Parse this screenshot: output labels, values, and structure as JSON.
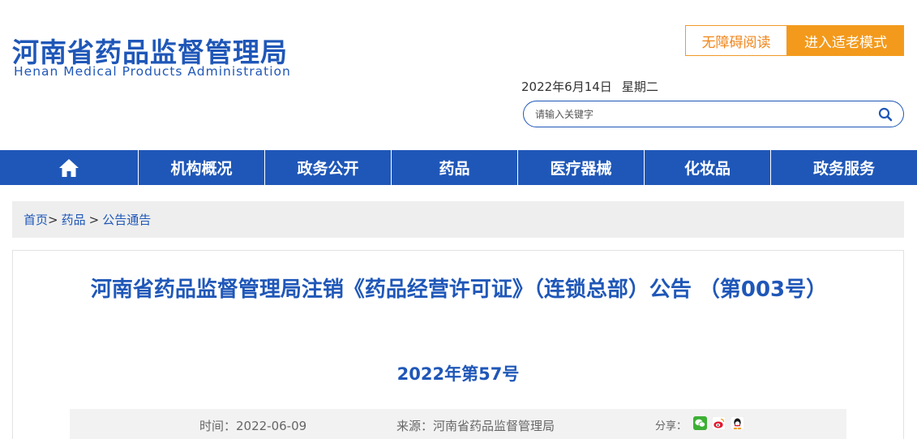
{
  "header": {
    "logo_cn": "河南省药品监督管理局",
    "logo_en": "Henan Medical Products Administration",
    "accessible_label": "无障碍阅读",
    "elder_mode_label": "进入适老模式",
    "date": "2022年6月14日",
    "weekday": "星期二",
    "search_placeholder": "请输入关键字"
  },
  "nav": {
    "items": [
      "机构概况",
      "政务公开",
      "药品",
      "医疗器械",
      "化妆品",
      "政务服务"
    ]
  },
  "breadcrumb": {
    "home": "首页",
    "level1": "药品",
    "level2": "公告通告",
    "sep1": ">",
    "sep2": ">"
  },
  "article": {
    "title": "河南省药品监督管理局注销《药品经营许可证》（连锁总部）公告 （第003号）",
    "number": "2022年第57号",
    "time": "时间：2022-06-09",
    "source": "来源：河南省药品监督管理局",
    "share_label": "分享："
  },
  "colors": {
    "brand_blue": "#1f57b8",
    "accent_orange": "#f39a1c"
  }
}
